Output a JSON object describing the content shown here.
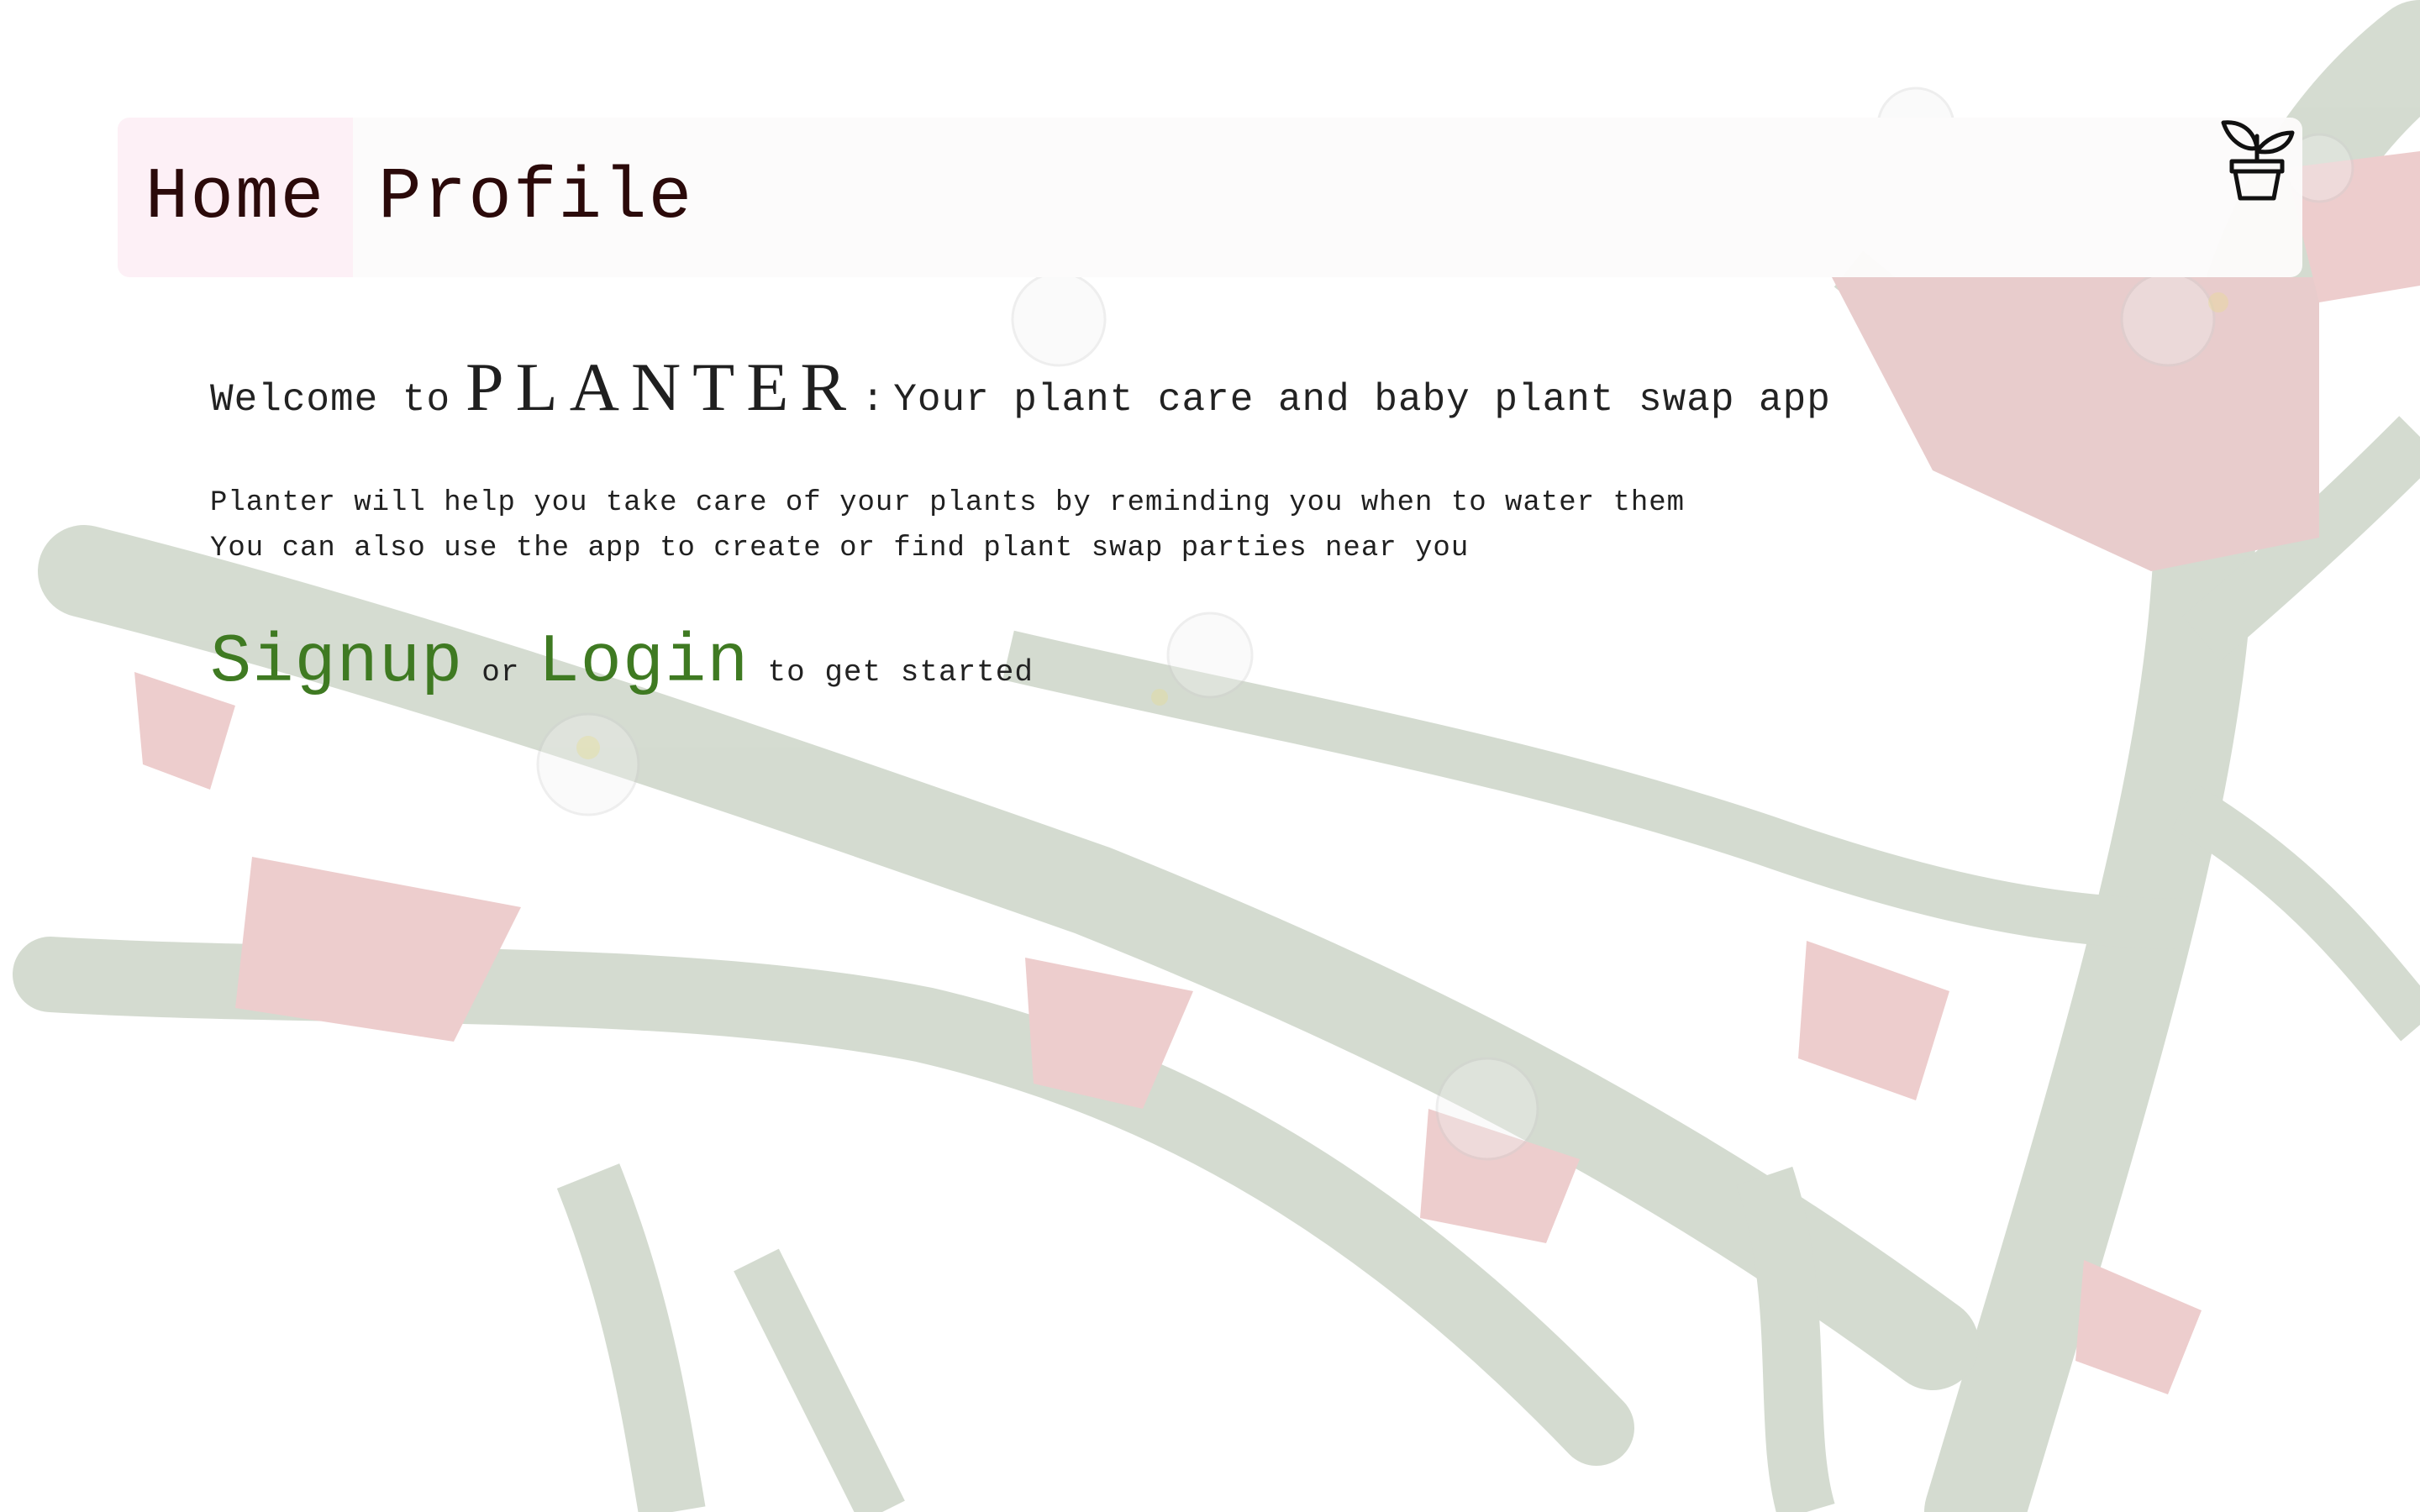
{
  "nav": {
    "home_label": "Home",
    "profile_label": "Profile",
    "logo_icon": "potted-plant-icon"
  },
  "welcome": {
    "prefix": "Welcome to",
    "brand": "PLANTER",
    "separator": ":",
    "tagline": "Your plant care and baby plant swap app"
  },
  "description": {
    "line1": "Planter will help you take care of your plants by reminding you when to water them",
    "line2": "You can also use the app to create or find plant swap parties near you"
  },
  "cta": {
    "signup_label": "Signup",
    "or_text": "or",
    "login_label": "Login",
    "suffix": "to get started"
  },
  "colors": {
    "link_green": "#3f7a22",
    "home_tab_bg": "#fdf0f6",
    "nav_text": "#2b0a0a"
  }
}
